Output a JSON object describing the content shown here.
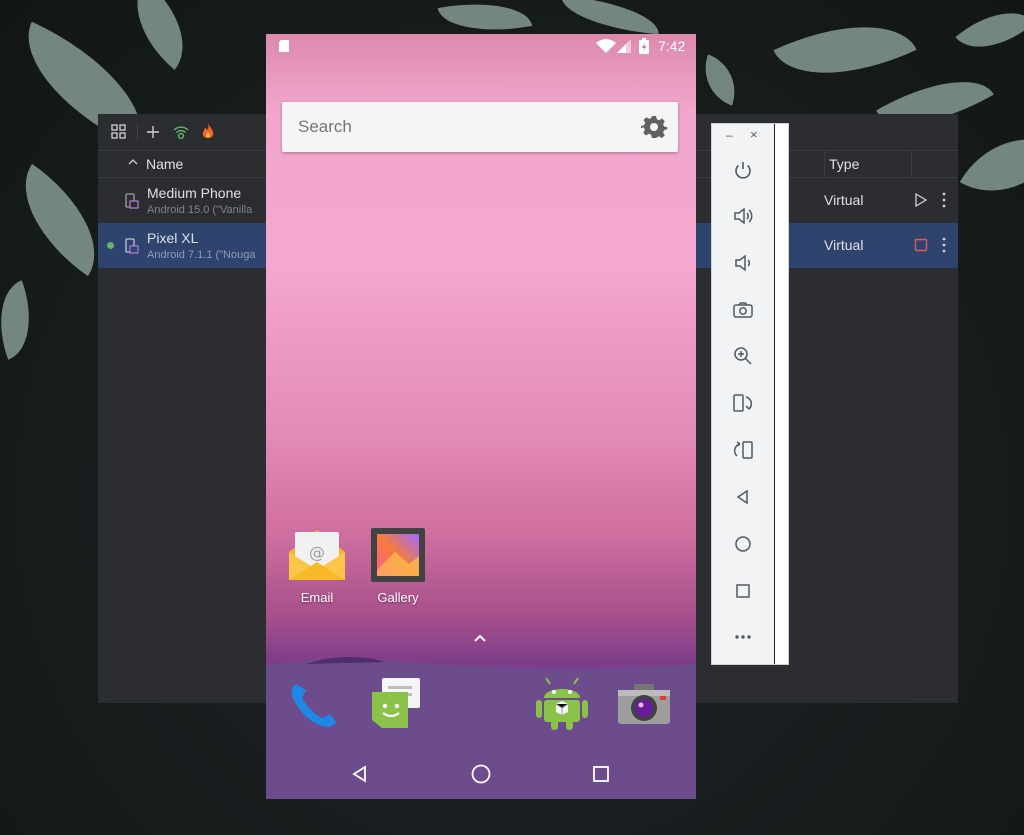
{
  "device_manager": {
    "columns": {
      "name": "Name",
      "type": "Type"
    },
    "devices": [
      {
        "name": "Medium Phone",
        "subtitle": "Android 15.0 (\"Vanilla",
        "type": "Virtual",
        "running": false,
        "selected": false,
        "action": "play-icon"
      },
      {
        "name": "Pixel XL",
        "subtitle": "Android 7.1.1 (\"Nouga",
        "type": "Virtual",
        "running": true,
        "selected": true,
        "action": "stop-icon"
      }
    ]
  },
  "emulator_toolbar": {
    "minimize": "–",
    "close": "×",
    "tools": [
      "power-icon",
      "volume-up-icon",
      "volume-down-icon",
      "screenshot-icon",
      "zoom-icon",
      "rotate-left-icon",
      "rotate-right-icon",
      "back-icon",
      "home-icon",
      "overview-icon",
      "more-icon"
    ]
  },
  "phone": {
    "time": "7:42",
    "search_placeholder": "Search",
    "apps": [
      {
        "label": "Email"
      },
      {
        "label": "Gallery"
      }
    ],
    "dock": [
      "phone-icon",
      "messaging-icon",
      "android-icon",
      "camera-icon"
    ]
  },
  "colors": {
    "panel_bg": "#2b2d30",
    "selected_row": "#2e436e",
    "running_dot": "#5fb865",
    "stop_red": "#e55757"
  }
}
